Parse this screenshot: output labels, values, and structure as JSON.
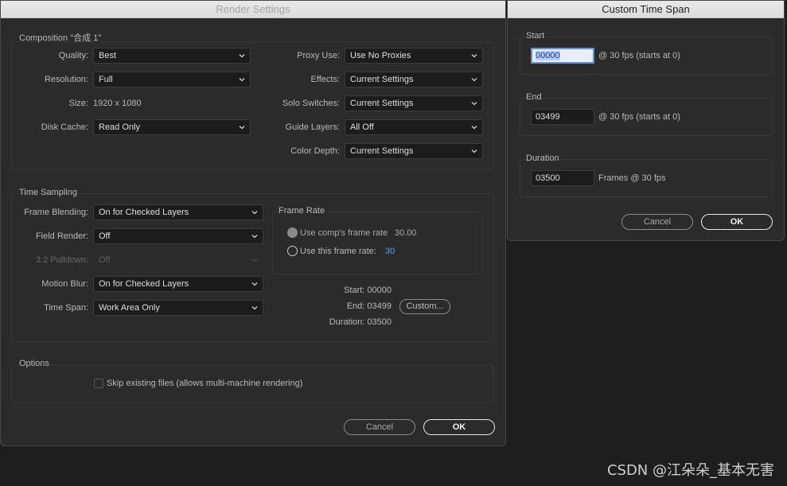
{
  "render_settings": {
    "title": "Render Settings",
    "composition": {
      "legend": "Composition \"合成 1\"",
      "quality": {
        "label": "Quality:",
        "value": "Best"
      },
      "resolution": {
        "label": "Resolution:",
        "value": "Full"
      },
      "size": {
        "label": "Size:",
        "value": "1920 x 1080"
      },
      "disk_cache": {
        "label": "Disk Cache:",
        "value": "Read Only"
      },
      "proxy_use": {
        "label": "Proxy Use:",
        "value": "Use No Proxies"
      },
      "effects": {
        "label": "Effects:",
        "value": "Current Settings"
      },
      "solo_switches": {
        "label": "Solo Switches:",
        "value": "Current Settings"
      },
      "guide_layers": {
        "label": "Guide Layers:",
        "value": "All Off"
      },
      "color_depth": {
        "label": "Color Depth:",
        "value": "Current Settings"
      }
    },
    "time_sampling": {
      "legend": "Time Sampling",
      "frame_blending": {
        "label": "Frame Blending:",
        "value": "On for Checked Layers"
      },
      "field_render": {
        "label": "Field Render:",
        "value": "Off"
      },
      "pulldown": {
        "label": "3:2 Pulldown:",
        "value": "Off"
      },
      "motion_blur": {
        "label": "Motion Blur:",
        "value": "On for Checked Layers"
      },
      "time_span": {
        "label": "Time Span:",
        "value": "Work Area Only"
      },
      "frame_rate": {
        "legend": "Frame Rate",
        "use_comp_label": "Use comp's frame rate",
        "use_comp_value": "30.00",
        "use_this_label": "Use this frame rate:",
        "use_this_value": "30"
      },
      "start": "Start: 00000",
      "end": "End: 03499",
      "duration": "Duration: 03500",
      "custom_label": "Custom..."
    },
    "options": {
      "legend": "Options",
      "skip_existing": "Skip existing files (allows multi-machine rendering)"
    },
    "cancel_label": "Cancel",
    "ok_label": "OK"
  },
  "custom_time_span": {
    "title": "Custom Time Span",
    "start": {
      "legend": "Start",
      "value": "00000",
      "suffix": "@ 30 fps (starts at 0)"
    },
    "end": {
      "legend": "End",
      "value": "03499",
      "suffix": "@ 30 fps (starts at 0)"
    },
    "duration": {
      "legend": "Duration",
      "value": "03500",
      "suffix": "Frames @ 30 fps"
    },
    "cancel_label": "Cancel",
    "ok_label": "OK"
  },
  "watermark": "CSDN @江朵朵_基本无害"
}
